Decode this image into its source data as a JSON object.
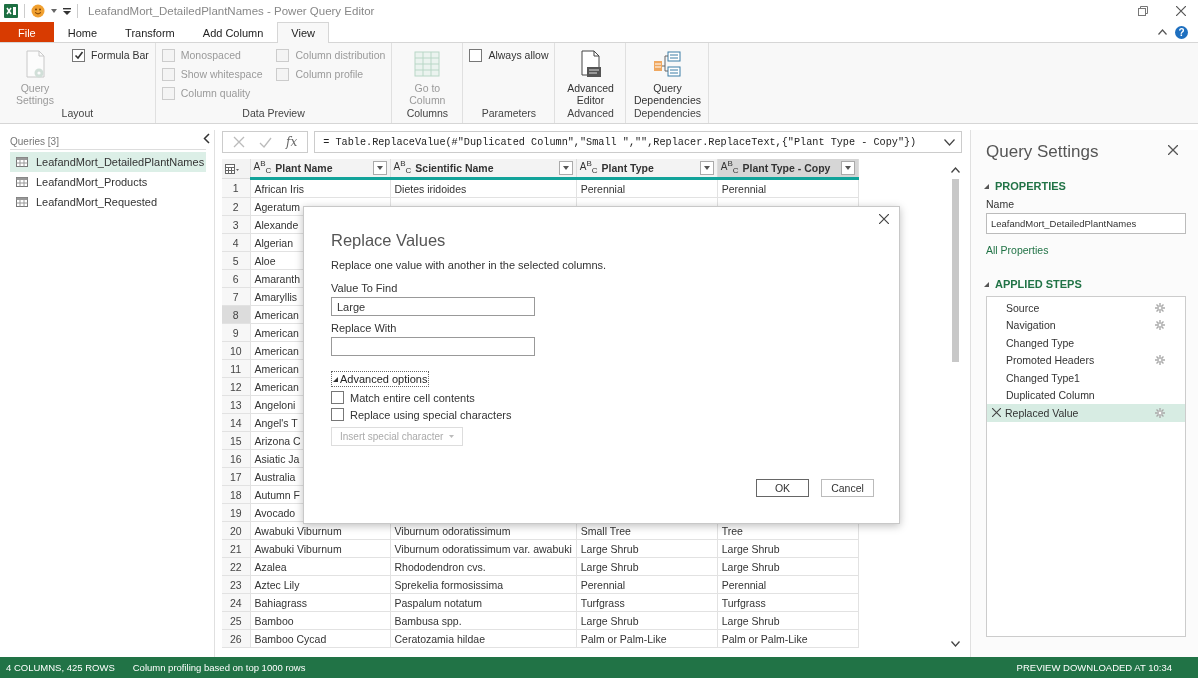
{
  "window": {
    "title": "LeafandMort_DetailedPlantNames - Power Query Editor",
    "help": "?"
  },
  "ribbon_tabs": [
    {
      "label": "File",
      "kind": "file",
      "selected": false
    },
    {
      "label": "Home",
      "kind": "tab",
      "selected": false
    },
    {
      "label": "Transform",
      "kind": "tab",
      "selected": false
    },
    {
      "label": "Add Column",
      "kind": "tab",
      "selected": false
    },
    {
      "label": "View",
      "kind": "tab",
      "selected": true
    }
  ],
  "ribbon_groups": [
    {
      "label": "Layout",
      "items": [
        {
          "kind": "large",
          "label": "Query Settings",
          "disabled": true
        },
        {
          "kind": "checkbox",
          "label": "Formula Bar",
          "checked": true,
          "disabled": false
        }
      ]
    },
    {
      "label": "Data Preview",
      "items": [
        {
          "kind": "checkbox",
          "label": "Monospaced",
          "checked": false,
          "disabled": true
        },
        {
          "kind": "checkbox",
          "label": "Show whitespace",
          "checked": false,
          "disabled": true
        },
        {
          "kind": "checkbox",
          "label": "Column quality",
          "checked": false,
          "disabled": true
        },
        {
          "kind": "checkbox",
          "label": "Column distribution",
          "checked": false,
          "disabled": true
        },
        {
          "kind": "checkbox",
          "label": "Column profile",
          "checked": false,
          "disabled": true
        }
      ]
    },
    {
      "label": "Columns",
      "items": [
        {
          "kind": "large",
          "label": "Go to Column",
          "disabled": true
        }
      ]
    },
    {
      "label": "Parameters",
      "items": [
        {
          "kind": "checkbox",
          "label": "Always allow",
          "checked": false,
          "disabled": false
        }
      ]
    },
    {
      "label": "Advanced",
      "items": [
        {
          "kind": "large",
          "label": "Advanced Editor",
          "disabled": false
        }
      ]
    },
    {
      "label": "Dependencies",
      "items": [
        {
          "kind": "large",
          "label": "Query Dependencies",
          "disabled": false
        }
      ]
    }
  ],
  "queries": {
    "header": "Queries [3]",
    "items": [
      {
        "label": "LeafandMort_DetailedPlantNames",
        "selected": true
      },
      {
        "label": "LeafandMort_Products",
        "selected": false
      },
      {
        "label": "LeafandMort_Requested",
        "selected": false
      }
    ]
  },
  "formula_bar": {
    "fx": "fx",
    "formula": "= Table.ReplaceValue(#\"Duplicated Column\",\"Small \",\"\",Replacer.ReplaceText,{\"Plant Type - Copy\"})"
  },
  "table": {
    "columns": [
      {
        "type": "A$^{B}$$_{C}$",
        "label": "Plant Name",
        "selected": false
      },
      {
        "type": "A$^{B}$$_{C}$",
        "label": "Scientific Name",
        "selected": false
      },
      {
        "type": "A$^{B}$$_{C}$",
        "label": "Plant Type",
        "selected": false
      },
      {
        "type": "A$^{B}$$_{C}$",
        "label": "Plant Type - Copy",
        "selected": true
      }
    ],
    "rows": [
      {
        "number": "1",
        "selected": false,
        "cells": [
          "African Iris",
          "Dietes iridoides",
          "Perennial",
          "Perennial"
        ]
      },
      {
        "number": "2",
        "selected": false,
        "cells": [
          "Ageratum"
        ]
      },
      {
        "number": "3",
        "selected": false,
        "cells": [
          "Alexande"
        ]
      },
      {
        "number": "4",
        "selected": false,
        "cells": [
          "Algerian"
        ]
      },
      {
        "number": "5",
        "selected": false,
        "cells": [
          "Aloe"
        ]
      },
      {
        "number": "6",
        "selected": false,
        "cells": [
          "Amaranth"
        ]
      },
      {
        "number": "7",
        "selected": false,
        "cells": [
          "Amaryllis"
        ]
      },
      {
        "number": "8",
        "selected": true,
        "cells": [
          "American"
        ]
      },
      {
        "number": "9",
        "selected": false,
        "cells": [
          "American"
        ]
      },
      {
        "number": "10",
        "selected": false,
        "cells": [
          "American"
        ]
      },
      {
        "number": "11",
        "selected": false,
        "cells": [
          "American"
        ]
      },
      {
        "number": "12",
        "selected": false,
        "cells": [
          "American"
        ]
      },
      {
        "number": "13",
        "selected": false,
        "cells": [
          "Angeloni"
        ]
      },
      {
        "number": "14",
        "selected": false,
        "cells": [
          "Angel's T"
        ]
      },
      {
        "number": "15",
        "selected": false,
        "cells": [
          "Arizona C"
        ]
      },
      {
        "number": "16",
        "selected": false,
        "cells": [
          "Asiatic Ja"
        ]
      },
      {
        "number": "17",
        "selected": false,
        "cells": [
          "Australia"
        ]
      },
      {
        "number": "18",
        "selected": false,
        "cells": [
          "Autumn F"
        ]
      },
      {
        "number": "19",
        "selected": false,
        "cells": [
          "Avocado"
        ]
      },
      {
        "number": "20",
        "selected": false,
        "cells": [
          "Awabuki Viburnum",
          "Viburnum odoratissimum",
          "Small Tree",
          "Tree"
        ]
      },
      {
        "number": "21",
        "selected": false,
        "cells": [
          "Awabuki Viburnum",
          "Viburnum odoratissimum var. awabuki",
          "Large Shrub",
          "Large Shrub"
        ]
      },
      {
        "number": "22",
        "selected": false,
        "cells": [
          "Azalea",
          "Rhododendron cvs.",
          "Large Shrub",
          "Large Shrub"
        ]
      },
      {
        "number": "23",
        "selected": false,
        "cells": [
          "Aztec Lily",
          "Sprekelia formosissima",
          "Perennial",
          "Perennial"
        ]
      },
      {
        "number": "24",
        "selected": false,
        "cells": [
          "Bahiagrass",
          "Paspalum notatum",
          "Turfgrass",
          "Turfgrass"
        ]
      },
      {
        "number": "25",
        "selected": false,
        "cells": [
          "Bamboo",
          "Bambusa spp.",
          "Large Shrub",
          "Large Shrub"
        ]
      },
      {
        "number": "26",
        "selected": false,
        "cells": [
          "Bamboo Cycad",
          "Ceratozamia hildae",
          "Palm or Palm-Like",
          "Palm or Palm-Like"
        ]
      }
    ]
  },
  "dialog": {
    "title": "Replace Values",
    "description": "Replace one value with another in the selected columns.",
    "fields": [
      {
        "label": "Value To Find",
        "value": "Large"
      },
      {
        "label": "Replace With"
      }
    ],
    "advanced": {
      "label": "Advanced options",
      "expanded": true
    },
    "options": [
      {
        "label": "Match entire cell contents",
        "checked": false
      },
      {
        "label": "Replace using special characters",
        "checked": false
      }
    ],
    "insert": {
      "label": "Insert special character",
      "disabled": true
    },
    "buttons": [
      {
        "label": "OK",
        "kind": "primary"
      },
      {
        "label": "Cancel",
        "kind": "secondary"
      }
    ]
  },
  "query_settings": {
    "title": "Query Settings",
    "properties_header": "PROPERTIES",
    "name_label": "Name",
    "name_value": "LeafandMort_DetailedPlantNames",
    "all_properties": "All Properties",
    "steps_header": "APPLIED STEPS",
    "steps": [
      {
        "label": "Source",
        "has_settings": true,
        "selected": false
      },
      {
        "label": "Navigation",
        "has_settings": true,
        "selected": false
      },
      {
        "label": "Changed Type",
        "has_settings": false,
        "selected": false
      },
      {
        "label": "Promoted Headers",
        "has_settings": true,
        "selected": false
      },
      {
        "label": "Changed Type1",
        "has_settings": false,
        "selected": false
      },
      {
        "label": "Duplicated Column",
        "has_settings": false,
        "selected": false
      },
      {
        "label": "Replaced Value",
        "has_settings": true,
        "selected": true
      }
    ]
  },
  "status_bar": {
    "left": [
      "4 COLUMNS, 425 ROWS",
      "Column profiling based on top 1000 rows"
    ],
    "right": "PREVIEW DOWNLOADED AT 10:34"
  }
}
